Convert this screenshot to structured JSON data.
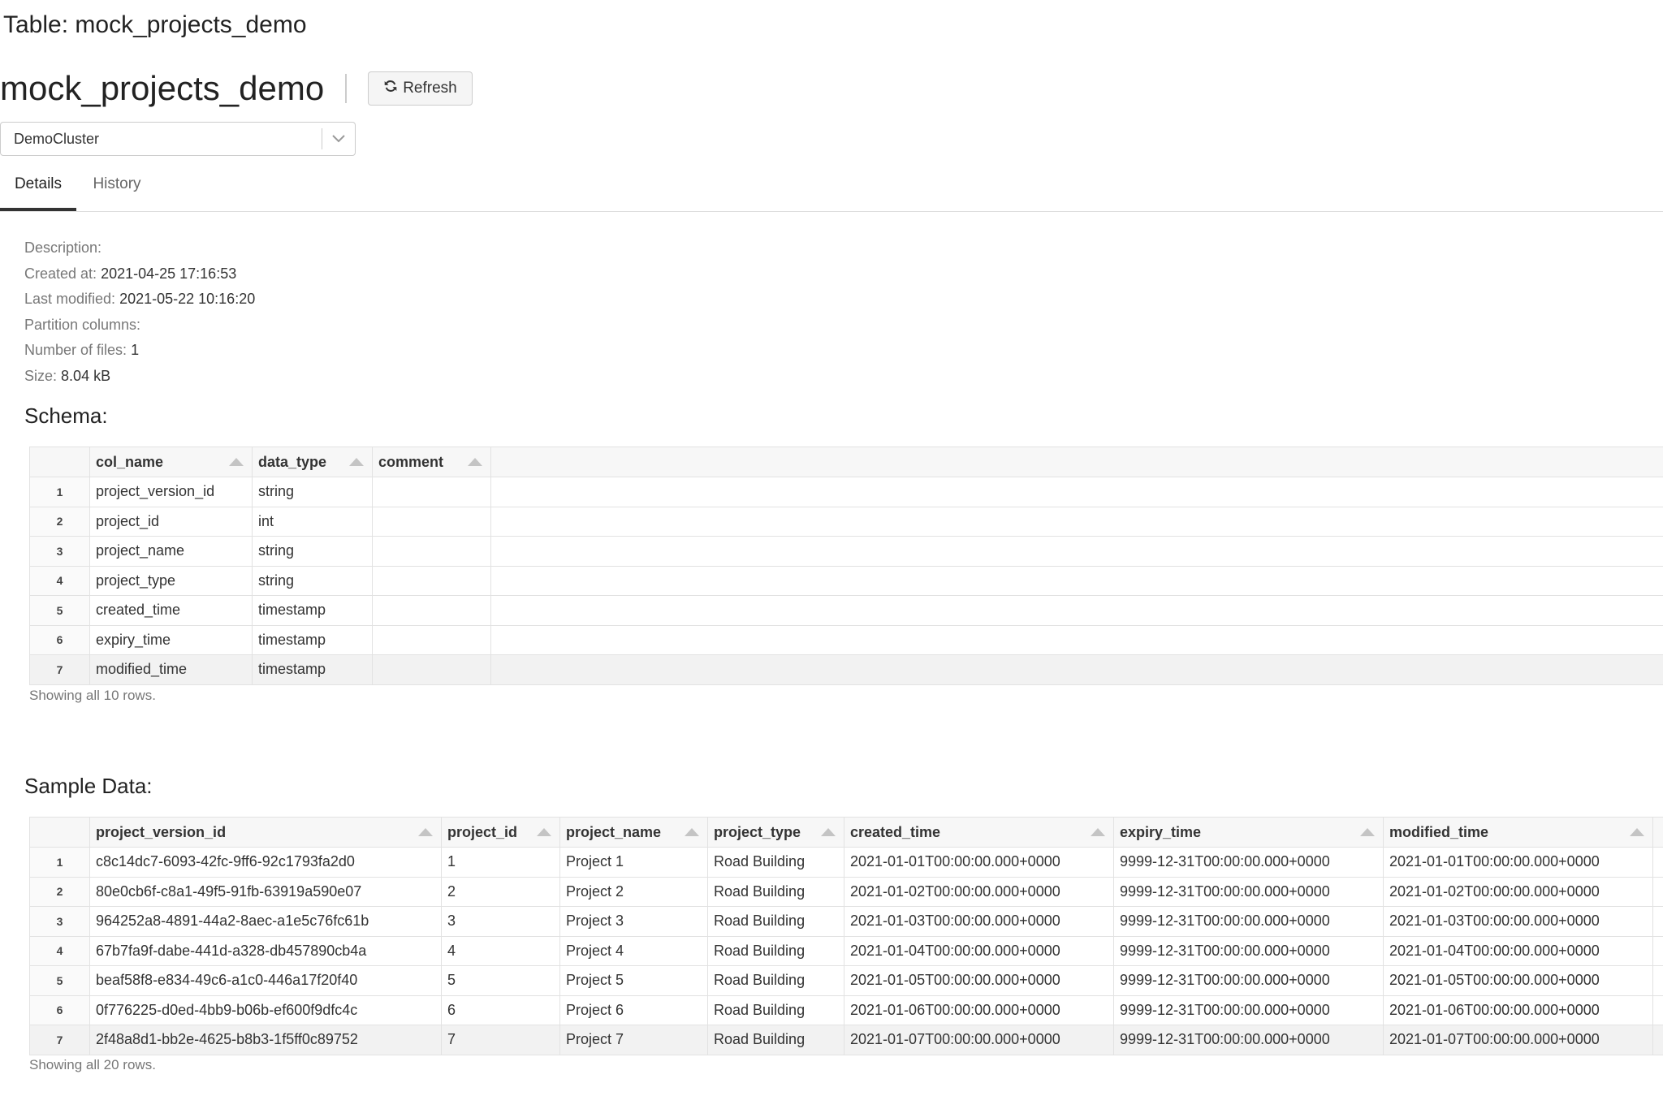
{
  "window": {
    "title": "Table: mock_projects_demo"
  },
  "header": {
    "table_name": "mock_projects_demo",
    "refresh_label": "Refresh"
  },
  "cluster_select": {
    "value": "DemoCluster"
  },
  "tabs": [
    {
      "label": "Details"
    },
    {
      "label": "History"
    }
  ],
  "details": {
    "description_label": "Description:",
    "description_value": "",
    "created_label": "Created at:",
    "created_value": "2021-04-25 17:16:53",
    "modified_label": "Last modified:",
    "modified_value": "2021-05-22 10:16:20",
    "partition_label": "Partition columns:",
    "partition_value": "",
    "files_label": "Number of files:",
    "files_value": "1",
    "size_label": "Size:",
    "size_value": "8.04 kB"
  },
  "schema": {
    "title": "Schema:",
    "columns": [
      "col_name",
      "data_type",
      "comment"
    ],
    "rows": [
      [
        "1",
        "project_version_id",
        "string",
        ""
      ],
      [
        "2",
        "project_id",
        "int",
        ""
      ],
      [
        "3",
        "project_name",
        "string",
        ""
      ],
      [
        "4",
        "project_type",
        "string",
        ""
      ],
      [
        "5",
        "created_time",
        "timestamp",
        ""
      ],
      [
        "6",
        "expiry_time",
        "timestamp",
        ""
      ],
      [
        "7",
        "modified_time",
        "timestamp",
        ""
      ]
    ],
    "footer": "Showing all 10 rows."
  },
  "sample": {
    "title": "Sample Data:",
    "columns": [
      "project_version_id",
      "project_id",
      "project_name",
      "project_type",
      "created_time",
      "expiry_time",
      "modified_time"
    ],
    "rows": [
      [
        "1",
        "c8c14dc7-6093-42fc-9ff6-92c1793fa2d0",
        "1",
        "Project 1",
        "Road Building",
        "2021-01-01T00:00:00.000+0000",
        "9999-12-31T00:00:00.000+0000",
        "2021-01-01T00:00:00.000+0000"
      ],
      [
        "2",
        "80e0cb6f-c8a1-49f5-91fb-63919a590e07",
        "2",
        "Project 2",
        "Road Building",
        "2021-01-02T00:00:00.000+0000",
        "9999-12-31T00:00:00.000+0000",
        "2021-01-02T00:00:00.000+0000"
      ],
      [
        "3",
        "964252a8-4891-44a2-8aec-a1e5c76fc61b",
        "3",
        "Project 3",
        "Road Building",
        "2021-01-03T00:00:00.000+0000",
        "9999-12-31T00:00:00.000+0000",
        "2021-01-03T00:00:00.000+0000"
      ],
      [
        "4",
        "67b7fa9f-dabe-441d-a328-db457890cb4a",
        "4",
        "Project 4",
        "Road Building",
        "2021-01-04T00:00:00.000+0000",
        "9999-12-31T00:00:00.000+0000",
        "2021-01-04T00:00:00.000+0000"
      ],
      [
        "5",
        "beaf58f8-e834-49c6-a1c0-446a17f20f40",
        "5",
        "Project 5",
        "Road Building",
        "2021-01-05T00:00:00.000+0000",
        "9999-12-31T00:00:00.000+0000",
        "2021-01-05T00:00:00.000+0000"
      ],
      [
        "6",
        "0f776225-d0ed-4bb9-b06b-ef600f9dfc4c",
        "6",
        "Project 6",
        "Road Building",
        "2021-01-06T00:00:00.000+0000",
        "9999-12-31T00:00:00.000+0000",
        "2021-01-06T00:00:00.000+0000"
      ],
      [
        "7",
        "2f48a8d1-bb2e-4625-b8b3-1f5ff0c89752",
        "7",
        "Project 7",
        "Road Building",
        "2021-01-07T00:00:00.000+0000",
        "9999-12-31T00:00:00.000+0000",
        "2021-01-07T00:00:00.000+0000"
      ]
    ],
    "footer": "Showing all 20 rows."
  },
  "icons": {
    "refresh": "refresh-icon",
    "dropdown": "chevron-down-icon",
    "sort": "sort-asc-icon"
  }
}
